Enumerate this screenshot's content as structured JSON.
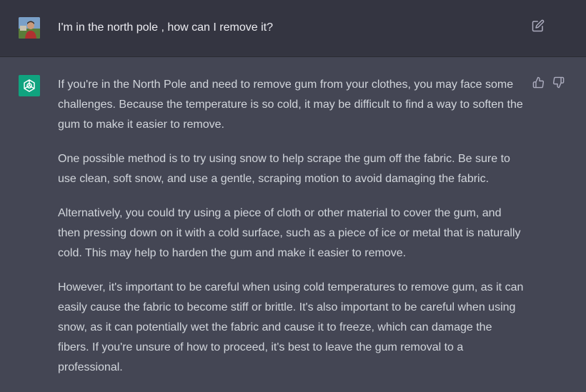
{
  "user_message": {
    "text": "I'm in the north pole , how can I remove it?",
    "avatar_icon": "user-avatar-photo",
    "edit_icon": "edit-icon"
  },
  "assistant_message": {
    "avatar_icon": "openai-logo-icon",
    "thumbs_up_icon": "thumbs-up-icon",
    "thumbs_down_icon": "thumbs-down-icon",
    "paragraphs": [
      "If you're in the North Pole and need to remove gum from your clothes, you may face some challenges. Because the temperature is so cold, it may be difficult to find a way to soften the gum to make it easier to remove.",
      "One possible method is to try using snow to help scrape the gum off the fabric. Be sure to use clean, soft snow, and use a gentle, scraping motion to avoid damaging the fabric.",
      "Alternatively, you could try using a piece of cloth or other material to cover the gum, and then pressing down on it with a cold surface, such as a piece of ice or metal that is naturally cold. This may help to harden the gum and make it easier to remove.",
      "However, it's important to be careful when using cold temperatures to remove gum, as it can easily cause the fabric to become stiff or brittle. It's also important to be careful when using snow, as it can potentially wet the fabric and cause it to freeze, which can damage the fibers. If you're unsure of how to proceed, it's best to leave the gum removal to a professional."
    ]
  },
  "colors": {
    "user_bg": "#343541",
    "assistant_bg": "#444654",
    "brand": "#10a37f",
    "text": "#d1d5db"
  }
}
